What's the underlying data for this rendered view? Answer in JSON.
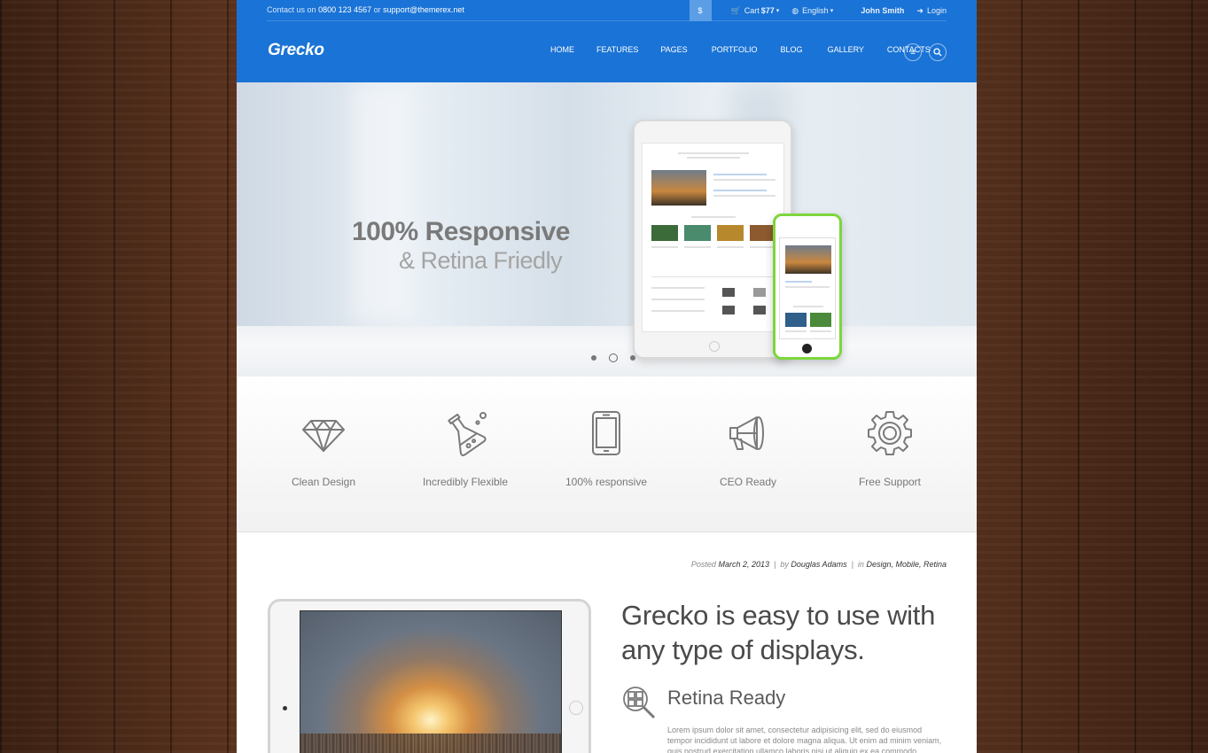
{
  "topbar": {
    "contact_prefix": "Contact us on",
    "phone": "0800 123 4567",
    "contact_mid": "or",
    "email": "support@themerex.net",
    "currency": "$",
    "cart_label": "Cart",
    "cart_amount": "$77",
    "language": "English",
    "user": "John Smith",
    "login": "Login"
  },
  "logo": "Grecko",
  "nav": [
    "HOME",
    "FEATURES",
    "PAGES",
    "PORTFOLIO",
    "BLOG",
    "GALLERY",
    "CONTACTS"
  ],
  "hero": {
    "headline": "100% Responsive",
    "subheadline": "& Retina Friedly"
  },
  "features": [
    {
      "label": "Clean Design",
      "icon": "diamond-icon"
    },
    {
      "label": "Incredibly Flexible",
      "icon": "flask-icon"
    },
    {
      "label": "100% responsive",
      "icon": "smartphone-icon"
    },
    {
      "label": "CEO Ready",
      "icon": "megaphone-icon"
    },
    {
      "label": "Free Support",
      "icon": "gear-icon"
    }
  ],
  "post": {
    "posted_label": "Posted",
    "date": "March 2, 2013",
    "by_label": "by",
    "author": "Douglas Adams",
    "in_label": "in",
    "categories": "Design, Mobile, Retina",
    "title": "Grecko is easy to use with any type of displays.",
    "section_title": "Retina Ready",
    "section_text": "Lorem ipsum dolor sit amet, consectetur adipisicing elit, sed do eiusmod tempor incididunt ut labore et dolore magna aliqua. Ut enim ad minim veniam, quis nostrud exercitation ullamco laboris nisi ut aliquip ex ea commodo"
  },
  "colors": {
    "brand": "#1a73d6",
    "phone_frame": "#7dd63c"
  }
}
